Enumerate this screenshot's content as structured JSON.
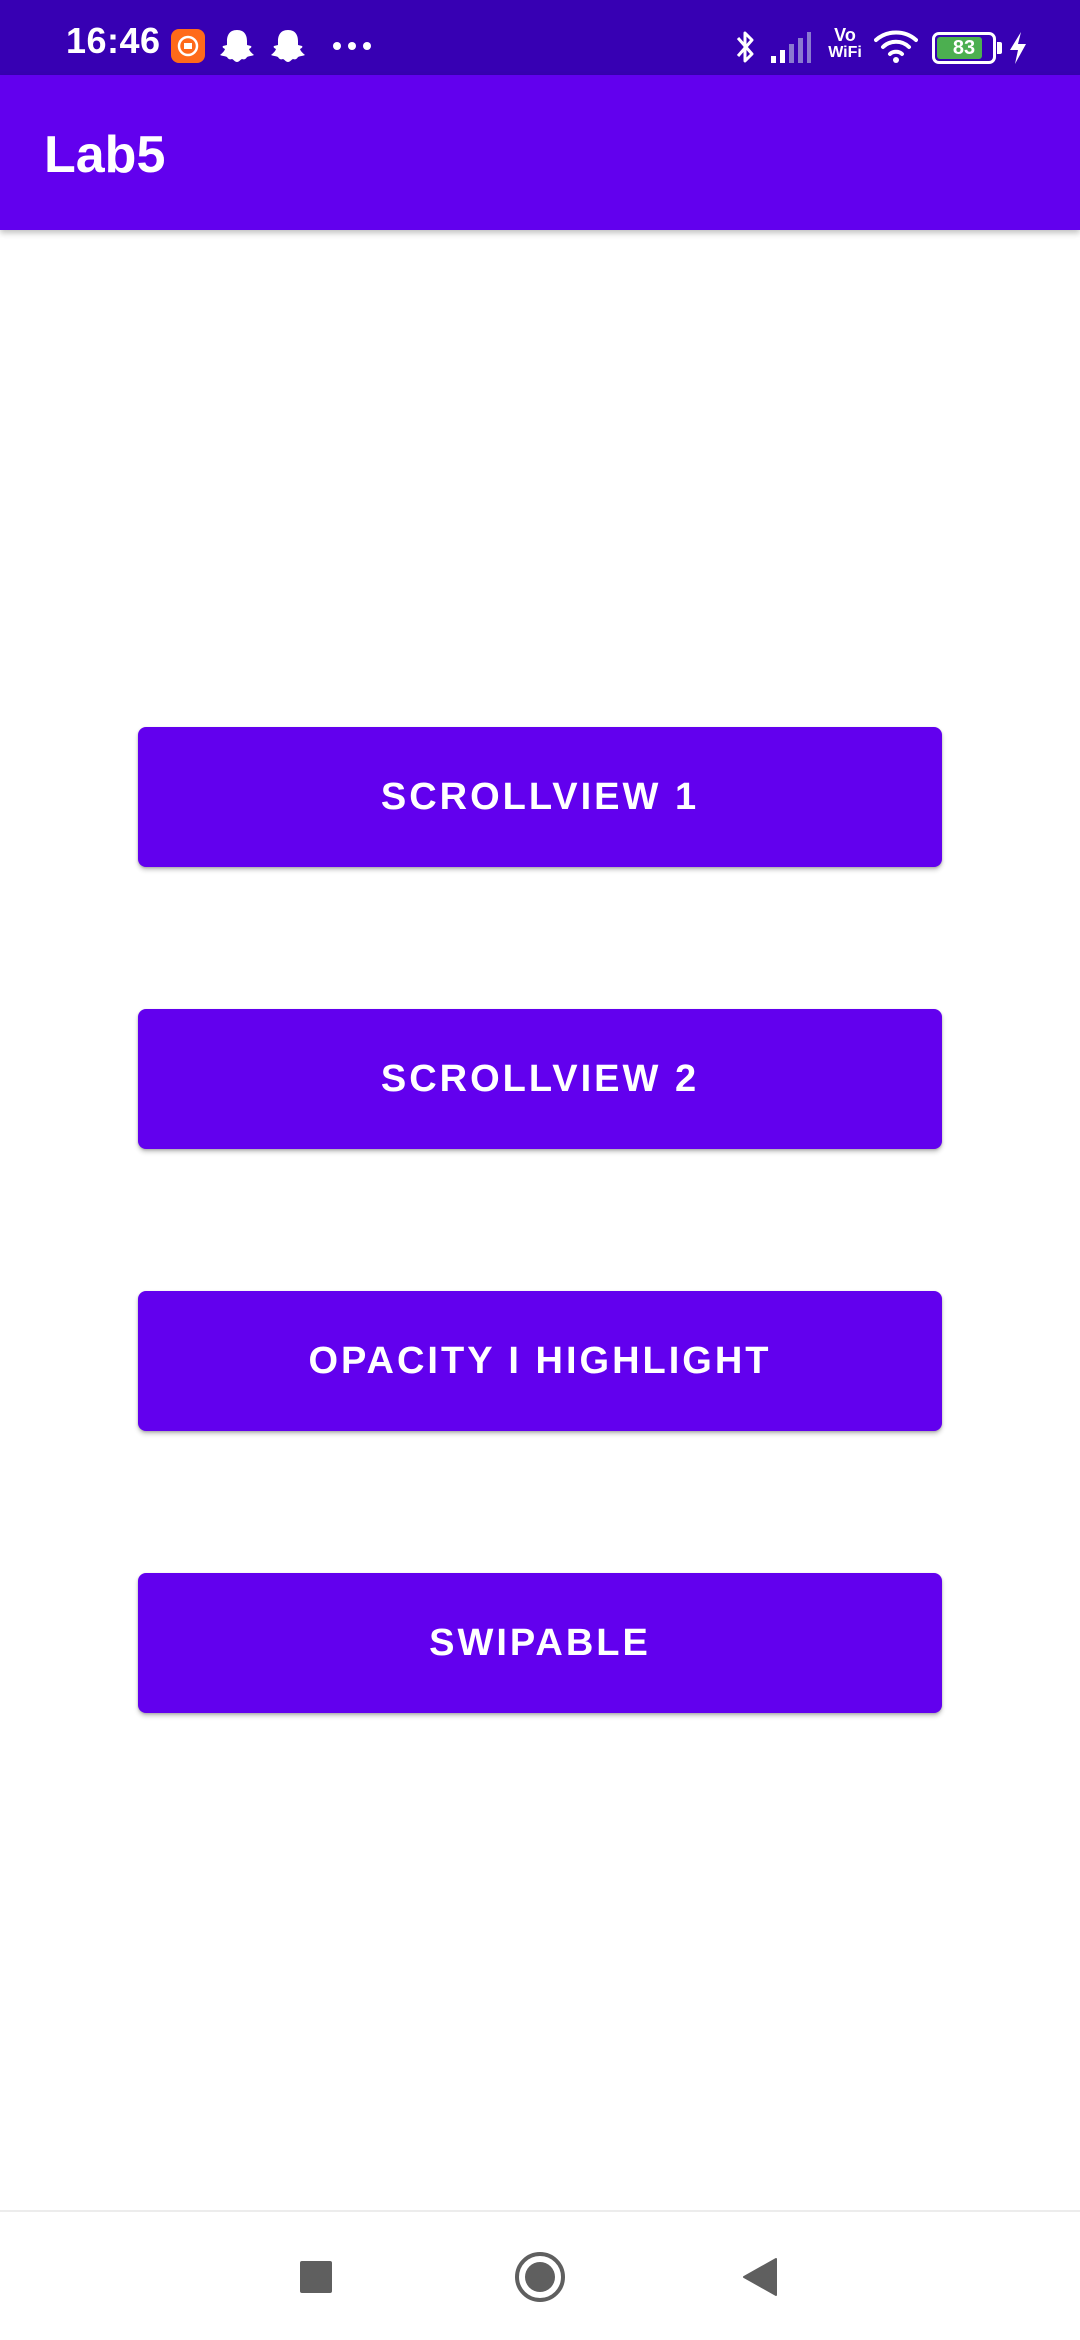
{
  "status_bar": {
    "time": "16:46",
    "battery_level": "83",
    "network_label_top": "Vo",
    "network_label_bottom": "WiFi",
    "icons": [
      "mi-app-icon",
      "snapchat-icon",
      "snapchat-icon",
      "more-dots-icon",
      "bluetooth-icon",
      "signal-icon",
      "vowifi-icon",
      "wifi-icon",
      "battery-icon",
      "charging-icon"
    ],
    "background_color": "#3700b3"
  },
  "app_bar": {
    "title": "Lab5",
    "background_color": "#6200ee"
  },
  "buttons": [
    {
      "label": "SCROLLVIEW 1"
    },
    {
      "label": "SCROLLVIEW 2"
    },
    {
      "label": "OPACITY I HIGHLIGHT"
    },
    {
      "label": "SWIPABLE"
    }
  ],
  "button_color": "#6200ee",
  "nav_bar": {
    "items": [
      "recents-square-icon",
      "home-circle-icon",
      "back-triangle-icon"
    ]
  }
}
